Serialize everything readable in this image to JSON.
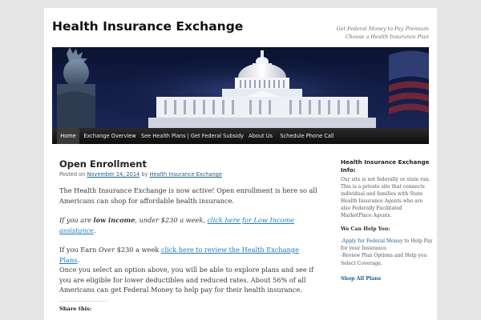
{
  "header": {
    "site_title": "Health Insurance Exchange",
    "tagline_line1": "Get Federal Money to Pay Premium",
    "tagline_line2": "Choose a Health Insurance Plan"
  },
  "nav": {
    "items": [
      "Home",
      "Exchange Overview",
      "See Health Plans | Get Federal Subsidy",
      "About Us",
      "Schedule Phone Call"
    ]
  },
  "post": {
    "title": "Open Enrollment",
    "meta_posted_on": "Posted on ",
    "meta_date": "November 14, 2014",
    "meta_by": " by ",
    "meta_author": "Health Insurance Exchange",
    "p1": "The Health Insurance Exchange is now active! Open enrollment is here so all Americans can shop for affordable health insurance.",
    "p2_prefix": "If you are ",
    "p2_bold": "low income",
    "p2_mid": ", under $230 a week, ",
    "p2_link": "click here for Low Income assistance",
    "p2_suffix": ".",
    "p3_prefix": "If you Earn ",
    "p3_over": "Over",
    "p3_mid": " $230 a week ",
    "p3_link": "click here to review the Health Exchange Plans",
    "p3_suffix": ".",
    "p4": "Once you select an option above, you will be able to explore plans and see if you are eligible for lower deductibles and reduced rates. About 56% of all Americans can get Federal Money to help pay for their health insurance.",
    "share_label": "Share this:"
  },
  "sidebar": {
    "info_title": "Health Insurance Exchange Info:",
    "info_text": "Our site is not federally or state run. This is a private site that connects individual and families with State Health Insurance Agents who are also Federally Facilitated MarketPlace Agents.",
    "help_title": "We Can Help You:",
    "help_item1_link": "-Apply for Federal Money",
    "help_item1_rest": " to Help Pay for your Insurance.",
    "help_item2": "-Review Plan Options and Help you Select Coverage.",
    "shop_all": "Shop All Plans"
  },
  "colors": {
    "background": "#e6e6e6",
    "nav_bar": "#1a1a1a",
    "link": "#1b7ac2",
    "banner_sky": "#131d48"
  }
}
